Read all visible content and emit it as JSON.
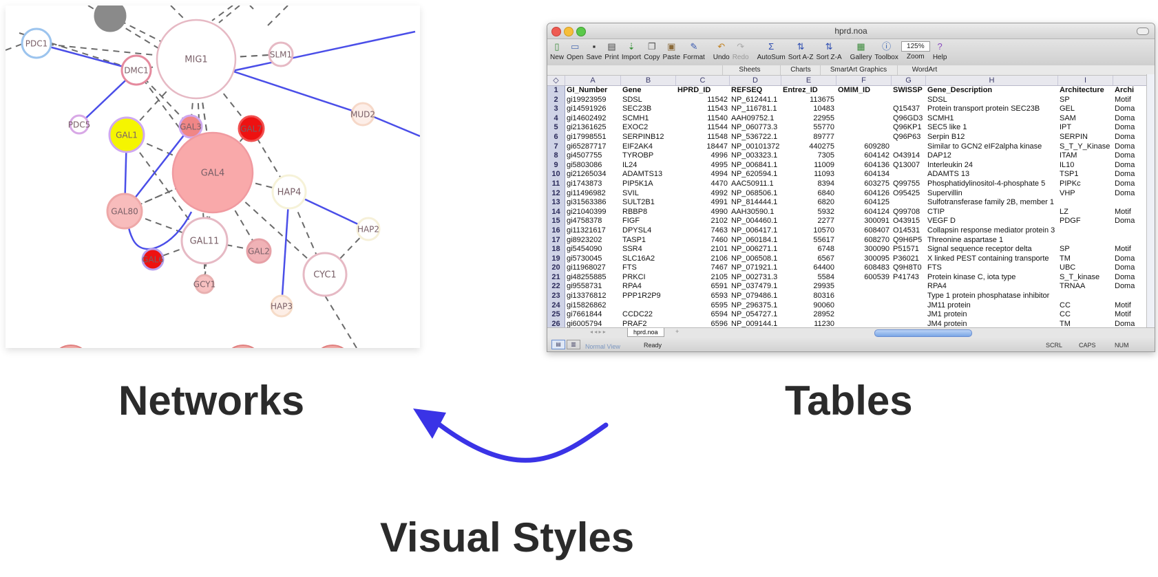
{
  "network": {
    "nodes": [
      {
        "id": "PDC1",
        "label": "PDC1",
        "color": "#ffffff",
        "stroke": "#9cc4ee"
      },
      {
        "id": "MIG1",
        "label": "MIG1",
        "color": "#ffffff",
        "stroke": "#e6b9c4"
      },
      {
        "id": "DMC1",
        "label": "DMC1",
        "color": "#ffffff",
        "stroke": "#e58a9e"
      },
      {
        "id": "SLM1",
        "label": "SLM1",
        "color": "#ffffff",
        "stroke": "#e6b9c4"
      },
      {
        "id": "MUD2",
        "label": "MUD2",
        "color": "#fdeee8",
        "stroke": "#f6d8c8"
      },
      {
        "id": "PDC5",
        "label": "PDC5",
        "color": "#ffffff",
        "stroke": "#d8a8e6"
      },
      {
        "id": "GAL1",
        "label": "GAL1",
        "color": "#f5f500",
        "stroke": "#cfa8f0"
      },
      {
        "id": "GAL3",
        "label": "GAL3",
        "color": "#f08686",
        "stroke": "#cfa8f0"
      },
      {
        "id": "GAL7",
        "label": "GAL7",
        "color": "#ee1111",
        "stroke": "#f05050"
      },
      {
        "id": "GAL4",
        "label": "GAL4",
        "color": "#f9a9aa",
        "stroke": "#f09aa0"
      },
      {
        "id": "HAP4",
        "label": "HAP4",
        "color": "#ffffff",
        "stroke": "#f6f2d8"
      },
      {
        "id": "GAL80",
        "label": "GAL80",
        "color": "#f8bcbc",
        "stroke": "#eea8a8"
      },
      {
        "id": "GAL11",
        "label": "GAL11",
        "color": "#ffffff",
        "stroke": "#e6b9c4"
      },
      {
        "id": "GAL2",
        "label": "GAL2",
        "color": "#f0b2b6",
        "stroke": "#e6a0a6"
      },
      {
        "id": "HAP2",
        "label": "HAP2",
        "color": "#ffffff",
        "stroke": "#f6f0d8"
      },
      {
        "id": "GAL6",
        "label": "GAL6",
        "color": "#ee1111",
        "stroke": "#b8a0ee"
      },
      {
        "id": "GCY1",
        "label": "GCY1",
        "color": "#f7c0c0",
        "stroke": "#e8b0b0"
      },
      {
        "id": "CYC1",
        "label": "CYC1",
        "color": "#ffffff",
        "stroke": "#e6b9c4"
      },
      {
        "id": "HAP3",
        "label": "HAP3",
        "color": "#fdeee6",
        "stroke": "#f6dcc8"
      },
      {
        "id": "GRAY",
        "label": "",
        "color": "#8a8a8a",
        "stroke": "#8a8a8a"
      }
    ],
    "edges": [
      {
        "from": "PDC1",
        "to": "DMC1",
        "style": "solid"
      },
      {
        "from": "DMC1",
        "to": "PDC5",
        "style": "solid"
      },
      {
        "from": "MIG1",
        "to": "SLM1",
        "style": "dashed"
      },
      {
        "from": "MIG1",
        "to": "MUD2",
        "style": "solid"
      },
      {
        "from": "GAL1",
        "to": "GAL80",
        "style": "solid"
      },
      {
        "from": "GAL3",
        "to": "GAL80",
        "style": "solid"
      },
      {
        "from": "HAP4",
        "to": "HAP2",
        "style": "solid"
      },
      {
        "from": "HAP4",
        "to": "HAP3",
        "style": "solid"
      },
      {
        "from": "GAL4",
        "to": "GAL80",
        "style": "dashed"
      },
      {
        "from": "GAL4",
        "to": "GAL11",
        "style": "dashed"
      },
      {
        "from": "MIG1",
        "to": "GAL4",
        "style": "dashed"
      }
    ]
  },
  "labels": {
    "networks": "Networks",
    "tables": "Tables",
    "visual_styles": "Visual Styles"
  },
  "colors": {
    "solid_edge": "#4a4ee8",
    "dashed_edge": "#6a6a6a",
    "arrow": "#3a33e6",
    "label_text": "#2b2b2b"
  },
  "sheet": {
    "title": "hprd.noa",
    "toolbar": [
      {
        "label": "New",
        "icon": "new-doc-icon",
        "glyph": "▯",
        "color": "#3a8a3a"
      },
      {
        "label": "Open",
        "icon": "open-icon",
        "glyph": "▭",
        "color": "#4a6ab0"
      },
      {
        "label": "Save",
        "icon": "save-icon",
        "glyph": "▪",
        "color": "#333"
      },
      {
        "label": "Print",
        "icon": "print-icon",
        "glyph": "▤",
        "color": "#444"
      },
      {
        "label": "Import",
        "icon": "import-icon",
        "glyph": "⇣",
        "color": "#2a8a2a"
      },
      {
        "label": "Copy",
        "icon": "copy-icon",
        "glyph": "❐",
        "color": "#555"
      },
      {
        "label": "Paste",
        "icon": "paste-icon",
        "glyph": "▣",
        "color": "#8a6a3a"
      },
      {
        "label": "Format",
        "icon": "format-brush-icon",
        "glyph": "✎",
        "color": "#3a5ab0"
      },
      {
        "label": "Undo",
        "icon": "undo-icon",
        "glyph": "↶",
        "color": "#c08020"
      },
      {
        "label": "Redo",
        "icon": "redo-icon",
        "glyph": "↷",
        "color": "#aaa"
      },
      {
        "label": "AutoSum",
        "icon": "autosum-icon",
        "glyph": "Σ",
        "color": "#2a4ab0"
      },
      {
        "label": "Sort A-Z",
        "icon": "sort-az-icon",
        "glyph": "⇅",
        "color": "#2a4ab0"
      },
      {
        "label": "Sort Z-A",
        "icon": "sort-za-icon",
        "glyph": "⇅",
        "color": "#2a4ab0"
      },
      {
        "label": "Gallery",
        "icon": "gallery-icon",
        "glyph": "▦",
        "color": "#3a8a3a"
      },
      {
        "label": "Toolbox",
        "icon": "toolbox-icon",
        "glyph": "ⓘ",
        "color": "#2a5ab0"
      },
      {
        "label": "Zoom",
        "icon": "zoom-select",
        "glyph": "125%",
        "color": "#222"
      },
      {
        "label": "Help",
        "icon": "help-icon",
        "glyph": "?",
        "color": "#8a4ac0"
      }
    ],
    "ribbon_tabs": [
      "Sheets",
      "Charts",
      "SmartArt Graphics",
      "WordArt"
    ],
    "columns": [
      "A",
      "B",
      "C",
      "D",
      "E",
      "F",
      "G",
      "H",
      "I"
    ],
    "headers": [
      "GI_Number",
      "Gene",
      "HPRD_ID",
      "REFSEQ",
      "Entrez_ID",
      "OMIM_ID",
      "SWISSP",
      "Gene_Description",
      "Architecture",
      "Archi"
    ],
    "rows": [
      [
        "gi19923959",
        "SDSL",
        "11542",
        "NP_612441.1",
        "113675",
        "",
        "",
        "SDSL",
        "SP",
        "Motif"
      ],
      [
        "gi14591926",
        "SEC23B",
        "11543",
        "NP_116781.1",
        "10483",
        "",
        "Q15437",
        "Protein transport protein SEC23B",
        "GEL",
        "Doma"
      ],
      [
        "gi14602492",
        "SCMH1",
        "11540",
        "AAH09752.1",
        "22955",
        "",
        "Q96GD3",
        "SCMH1",
        "SAM",
        "Doma"
      ],
      [
        "gi21361625",
        "EXOC2",
        "11544",
        "NP_060773.3",
        "55770",
        "",
        "Q96KP1",
        "SEC5 like 1",
        "IPT",
        "Doma"
      ],
      [
        "gi17998551",
        "SERPINB12",
        "11548",
        "NP_536722.1",
        "89777",
        "",
        "Q96P63",
        "Serpin B12",
        "SERPIN",
        "Doma"
      ],
      [
        "gi65287717",
        "EIF2AK4",
        "18447",
        "NP_00101372",
        "440275",
        "609280",
        "",
        "Similar to GCN2 eIF2alpha kinase",
        "S_T_Y_Kinase",
        "Doma"
      ],
      [
        "gi4507755",
        "TYROBP",
        "4996",
        "NP_003323.1",
        "7305",
        "604142",
        "O43914",
        "DAP12",
        "ITAM",
        "Doma"
      ],
      [
        "gi5803086",
        "IL24",
        "4995",
        "NP_006841.1",
        "11009",
        "604136",
        "Q13007",
        "Interleukin 24",
        "IL10",
        "Doma"
      ],
      [
        "gi21265034",
        "ADAMTS13",
        "4994",
        "NP_620594.1",
        "11093",
        "604134",
        "",
        "ADAMTS 13",
        "TSP1",
        "Doma"
      ],
      [
        "gi1743873",
        "PIP5K1A",
        "4470",
        "AAC50911.1",
        "8394",
        "603275",
        "Q99755",
        "Phosphatidylinositol-4-phosphate 5",
        "PIPKc",
        "Doma"
      ],
      [
        "gi11496982",
        "SVIL",
        "4992",
        "NP_068506.1",
        "6840",
        "604126",
        "O95425",
        "Supervillin",
        "VHP",
        "Doma"
      ],
      [
        "gi31563386",
        "SULT2B1",
        "4991",
        "NP_814444.1",
        "6820",
        "604125",
        "",
        "Sulfotransferase family 2B, member 1",
        "",
        ""
      ],
      [
        "gi21040399",
        "RBBP8",
        "4990",
        "AAH30590.1",
        "5932",
        "604124",
        "Q99708",
        "CTIP",
        "LZ",
        "Motif"
      ],
      [
        "gi4758378",
        "FIGF",
        "2102",
        "NP_004460.1",
        "2277",
        "300091",
        "O43915",
        "VEGF D",
        "PDGF",
        "Doma"
      ],
      [
        "gi11321617",
        "DPYSL4",
        "7463",
        "NP_006417.1",
        "10570",
        "608407",
        "O14531",
        "Collapsin response mediator protein 3",
        "",
        ""
      ],
      [
        "gi8923202",
        "TASP1",
        "7460",
        "NP_060184.1",
        "55617",
        "608270",
        "Q9H6P5",
        "Threonine aspartase 1",
        "",
        ""
      ],
      [
        "gi5454090",
        "SSR4",
        "2101",
        "NP_006271.1",
        "6748",
        "300090",
        "P51571",
        "Signal sequence receptor delta",
        "SP",
        "Motif"
      ],
      [
        "gi5730045",
        "SLC16A2",
        "2106",
        "NP_006508.1",
        "6567",
        "300095",
        "P36021",
        "X linked PEST containing transporte",
        "TM",
        "Doma"
      ],
      [
        "gi11968027",
        "FTS",
        "7467",
        "NP_071921.1",
        "64400",
        "608483",
        "Q9H8T0",
        "FTS",
        "UBC",
        "Doma"
      ],
      [
        "gi48255885",
        "PRKCI",
        "2105",
        "NP_002731.3",
        "5584",
        "600539",
        "P41743",
        "Protein kinase C, iota type",
        "S_T_kinase",
        "Doma"
      ],
      [
        "gi9558731",
        "RPA4",
        "6591",
        "NP_037479.1",
        "29935",
        "",
        "",
        "RPA4",
        "TRNAA",
        "Doma"
      ],
      [
        "gi13376812",
        "PPP1R2P9",
        "6593",
        "NP_079486.1",
        "80316",
        "",
        "",
        "Type 1 protein phosphatase inhibitor",
        "",
        ""
      ],
      [
        "gi15826862",
        "",
        "6595",
        "NP_296375.1",
        "90060",
        "",
        "",
        "JM11 protein",
        "CC",
        "Motif"
      ],
      [
        "gi7661844",
        "CCDC22",
        "6594",
        "NP_054727.1",
        "28952",
        "",
        "",
        "JM1 protein",
        "CC",
        "Motif"
      ],
      [
        "gi6005794",
        "PRAF2",
        "6596",
        "NP_009144.1",
        "11230",
        "",
        "",
        "JM4 protein",
        "TM",
        "Doma"
      ]
    ],
    "sheet_tab": "hprd.noa",
    "status": {
      "view": "Normal View",
      "ready": "Ready",
      "scrl": "SCRL",
      "caps": "CAPS",
      "num": "NUM"
    }
  }
}
